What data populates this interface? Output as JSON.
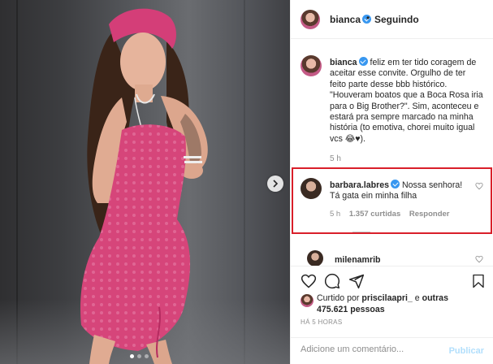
{
  "post": {
    "author": "bianca",
    "follow_status": "Seguindo",
    "separator": "•",
    "carousel_dots": 3,
    "active_dot": 0
  },
  "caption": {
    "username": "bianca",
    "text": "feliz em ter tido coragem de aceitar esse convite. Orgulho de ter feito parte desse bbb histórico. \"Houveram boatos que a Boca Rosa iria para o Big Brother?\". Sim, aconteceu e estará pra sempre marcado na minha história (to emotiva, chorei muito igual vcs 😂♥).",
    "time": "5 h"
  },
  "highlighted_comment": {
    "username": "barbara.labres",
    "text": "Nossa senhora! Tá gata ein minha filha",
    "time": "5 h",
    "likes": "1.357 curtidas",
    "reply_label": "Responder",
    "highlight_color": "#d91f2a"
  },
  "next_comment": {
    "username": "milenamrib"
  },
  "likes": {
    "prefix": "Curtido por",
    "user": "priscilaapri_",
    "connector": "e",
    "others": "outras 475.621 pessoas"
  },
  "timestamp": "HÁ 5 HORAS",
  "comment_box": {
    "placeholder": "Adicione um comentário...",
    "post_label": "Publicar"
  },
  "icons": [
    "verified-icon",
    "heart-icon",
    "comment-icon",
    "share-icon",
    "bookmark-icon",
    "chevron-right-icon"
  ],
  "colors": {
    "verified": "#3897f0",
    "dress": "#d6457a",
    "link_disabled": "#b2dffc"
  }
}
